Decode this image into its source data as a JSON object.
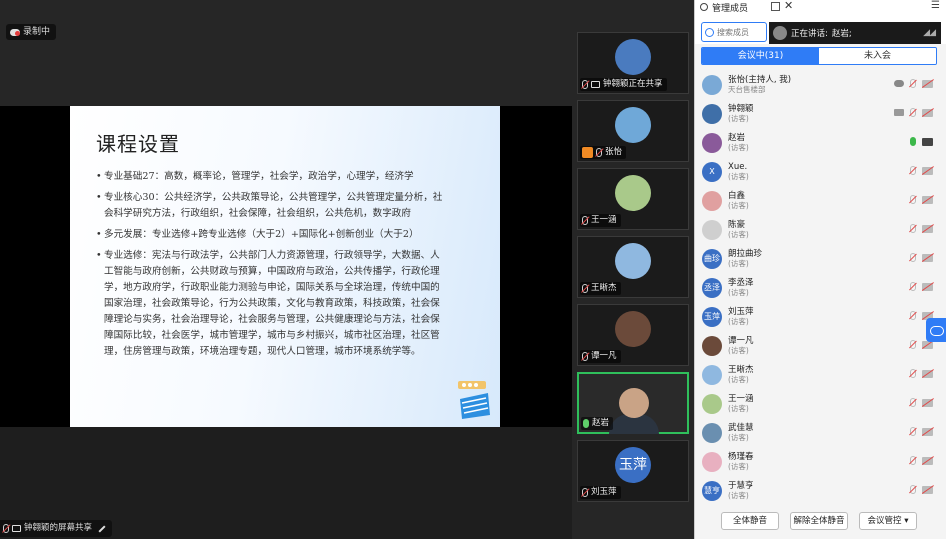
{
  "recording": {
    "label": "录制中"
  },
  "share_status": {
    "label": "钟翱颖的屏幕共享"
  },
  "slide": {
    "title": "课程设置",
    "bullets": [
      "专业基础27：高数，概率论，管理学，社会学，政治学，心理学，经济学",
      "专业核心30：公共经济学，公共政策导论，公共管理学，公共管理定量分析，社会科学研究方法，行政组织，社会保障，社会组织，公共危机，数字政府",
      "多元发展：专业选修+跨专业选修（大于2）+国际化+创新创业（大于2）",
      "专业选修：宪法与行政法学，公共部门人力资源管理，行政领导学，大数据、人工智能与政府创新，公共财政与预算，中国政府与政治，公共传播学，行政伦理学，地方政府学，行政职业能力测验与申论，国际关系与全球治理，传统中国的国家治理，社会政策导论，行为公共政策，文化与教育政策，科技政策，社会保障理论与实务，社会治理导论，社会服务与管理，公共健康理论与方法，社会保障国际比较，社会医学，城市管理学，城市与乡村振兴，城市社区治理，社区管理，住房管理与政策，环境治理专题，现代人口管理，城市环境系统学等。"
    ]
  },
  "videos": [
    {
      "name": "钟翱颖正在共享",
      "color": "#4a7bbf",
      "avatar_text": ""
    },
    {
      "name": "张怡",
      "color": "#6fa8d8",
      "avatar_text": ""
    },
    {
      "name": "王一涵",
      "color": "#a9c98a",
      "avatar_text": ""
    },
    {
      "name": "王晰杰",
      "color": "#8fb8e0",
      "avatar_text": ""
    },
    {
      "name": "谭一凡",
      "color": "#6b4a3a",
      "avatar_text": ""
    },
    {
      "name": "赵岩",
      "color": "",
      "avatar_text": ""
    },
    {
      "name": "刘玉萍",
      "color": "#3a6fc4",
      "avatar_text": "玉萍"
    }
  ],
  "panel": {
    "title": "管理成员",
    "search_placeholder": "搜索成员",
    "speaking_label": "正在讲话:",
    "speaking_name": "赵岩;",
    "tab_in_meeting": "会议中(31)",
    "tab_not_joined": "未入会",
    "members": [
      {
        "name": "张怡(主持人, 我)",
        "sub": "天台售楼部",
        "color": "#7aa9d6",
        "avatar_text": "",
        "mic": "muted",
        "cam": "off",
        "extra": "cloud"
      },
      {
        "name": "钟翱颖",
        "sub": "(访客)",
        "color": "#3f6fa8",
        "avatar_text": "",
        "mic": "muted",
        "cam": "off",
        "extra": "screen"
      },
      {
        "name": "赵岩",
        "sub": "(访客)",
        "color": "#8a5a9a",
        "avatar_text": "",
        "mic": "on",
        "cam": "on",
        "extra": ""
      },
      {
        "name": "Xue.",
        "sub": "(访客)",
        "color": "#3a6fc4",
        "avatar_text": "X",
        "mic": "muted",
        "cam": "off",
        "extra": ""
      },
      {
        "name": "白鑫",
        "sub": "(访客)",
        "color": "#e0a0a0",
        "avatar_text": "",
        "mic": "muted",
        "cam": "off",
        "extra": ""
      },
      {
        "name": "陈豪",
        "sub": "(访客)",
        "color": "#cfcfcf",
        "avatar_text": "",
        "mic": "muted",
        "cam": "off",
        "extra": ""
      },
      {
        "name": "朗拉曲珍",
        "sub": "(访客)",
        "color": "#3a6fc4",
        "avatar_text": "曲珍",
        "mic": "muted",
        "cam": "off",
        "extra": ""
      },
      {
        "name": "李丞泽",
        "sub": "(访客)",
        "color": "#3a6fc4",
        "avatar_text": "丞泽",
        "mic": "muted",
        "cam": "off",
        "extra": ""
      },
      {
        "name": "刘玉萍",
        "sub": "(访客)",
        "color": "#3a6fc4",
        "avatar_text": "玉萍",
        "mic": "muted",
        "cam": "off",
        "extra": ""
      },
      {
        "name": "谭一凡",
        "sub": "(访客)",
        "color": "#6b4a3a",
        "avatar_text": "",
        "mic": "muted",
        "cam": "off",
        "extra": ""
      },
      {
        "name": "王晰杰",
        "sub": "(访客)",
        "color": "#8fb8e0",
        "avatar_text": "",
        "mic": "muted",
        "cam": "off",
        "extra": ""
      },
      {
        "name": "王一涵",
        "sub": "(访客)",
        "color": "#a9c98a",
        "avatar_text": "",
        "mic": "muted",
        "cam": "off",
        "extra": ""
      },
      {
        "name": "武佳慧",
        "sub": "(访客)",
        "color": "#6a8fb0",
        "avatar_text": "",
        "mic": "muted",
        "cam": "off",
        "extra": ""
      },
      {
        "name": "杨瑾春",
        "sub": "(访客)",
        "color": "#e8b0c0",
        "avatar_text": "",
        "mic": "muted",
        "cam": "off",
        "extra": ""
      },
      {
        "name": "于慧亨",
        "sub": "(访客)",
        "color": "#3a6fc4",
        "avatar_text": "慧亨",
        "mic": "muted",
        "cam": "off",
        "extra": ""
      }
    ],
    "footer": {
      "mute_all": "全体静音",
      "unmute_all": "解除全体静音",
      "controls": "会议管控 ▾"
    }
  }
}
